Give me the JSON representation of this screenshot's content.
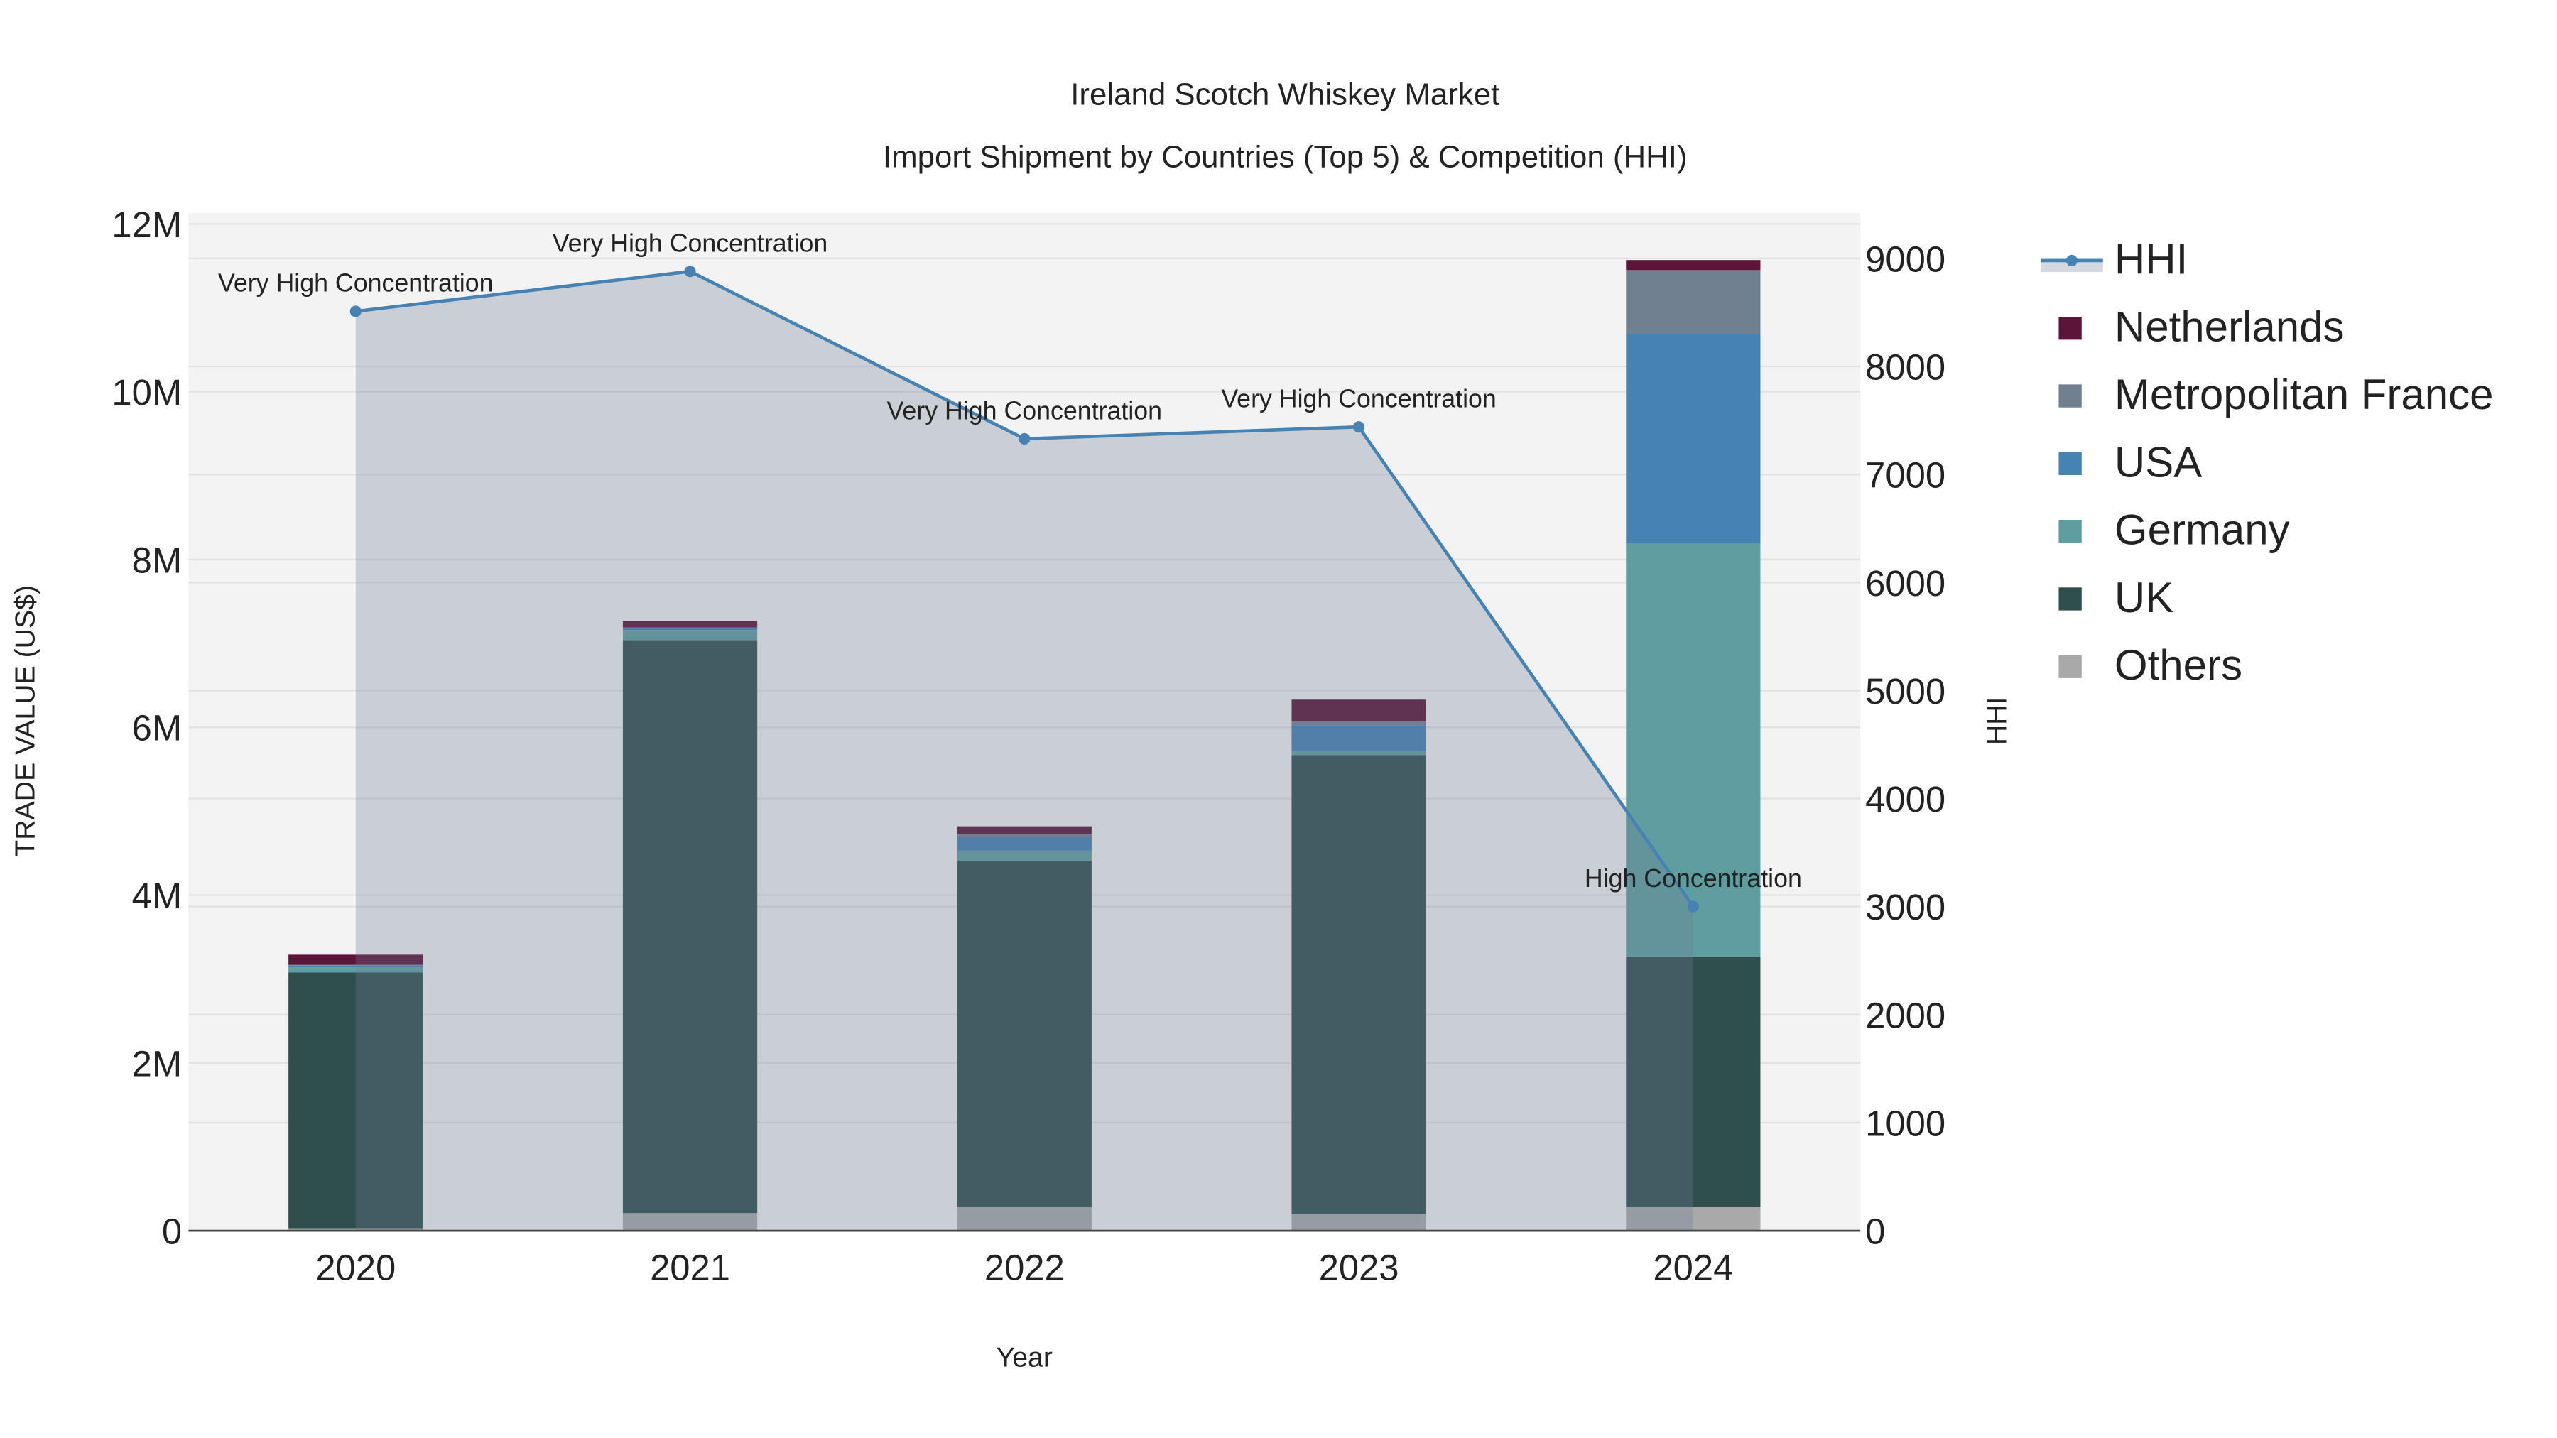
{
  "chart_data": {
    "type": "bar",
    "title": "Ireland Scotch Whiskey Market",
    "subtitle": "Import Shipment by Countries (Top 5) & Competition (HHI)",
    "xlabel": "Year",
    "ylabel": "TRADE VALUE (US$)",
    "y2label": "HHI",
    "categories": [
      "2020",
      "2021",
      "2022",
      "2023",
      "2024"
    ],
    "ylim": [
      0,
      12130000
    ],
    "y2lim": [
      0,
      9420
    ],
    "yticks": [
      0,
      2000000,
      4000000,
      6000000,
      8000000,
      10000000,
      12000000
    ],
    "ytick_labels": [
      "0",
      "2M",
      "4M",
      "6M",
      "8M",
      "10M",
      "12M"
    ],
    "y2ticks": [
      0,
      1000,
      2000,
      3000,
      4000,
      5000,
      6000,
      7000,
      8000,
      9000
    ],
    "y2tick_labels": [
      "0",
      "1000",
      "2000",
      "3000",
      "4000",
      "5000",
      "6000",
      "7000",
      "8000",
      "9000"
    ],
    "grid": true,
    "legend_position": "right",
    "series": [
      {
        "name": "Others",
        "color": "#a9a9a9",
        "values": [
          30000,
          210000,
          280000,
          200000,
          280000
        ]
      },
      {
        "name": "UK",
        "color": "#2f4f4f",
        "values": [
          3050000,
          6830000,
          4130000,
          5470000,
          2990000
        ]
      },
      {
        "name": "Germany",
        "color": "#5f9ea0",
        "values": [
          60000,
          120000,
          120000,
          50000,
          4930000
        ]
      },
      {
        "name": "USA",
        "color": "#4682b4",
        "values": [
          20000,
          20000,
          160000,
          300000,
          2490000
        ]
      },
      {
        "name": "Metropolitan France",
        "color": "#708090",
        "values": [
          10000,
          10000,
          40000,
          50000,
          760000
        ]
      },
      {
        "name": "Netherlands",
        "color": "#5c1538",
        "values": [
          120000,
          80000,
          90000,
          260000,
          120000
        ]
      }
    ],
    "hhi": {
      "name": "HHI",
      "color": "#4682b4",
      "values": [
        8510,
        8880,
        7330,
        7440,
        3000
      ],
      "annotations": [
        "Very High Concentration",
        "Very High Concentration",
        "Very High Concentration",
        "Very High Concentration",
        "High Concentration"
      ]
    },
    "legend": [
      "HHI",
      "Netherlands",
      "Metropolitan France",
      "USA",
      "Germany",
      "UK",
      "Others"
    ]
  }
}
